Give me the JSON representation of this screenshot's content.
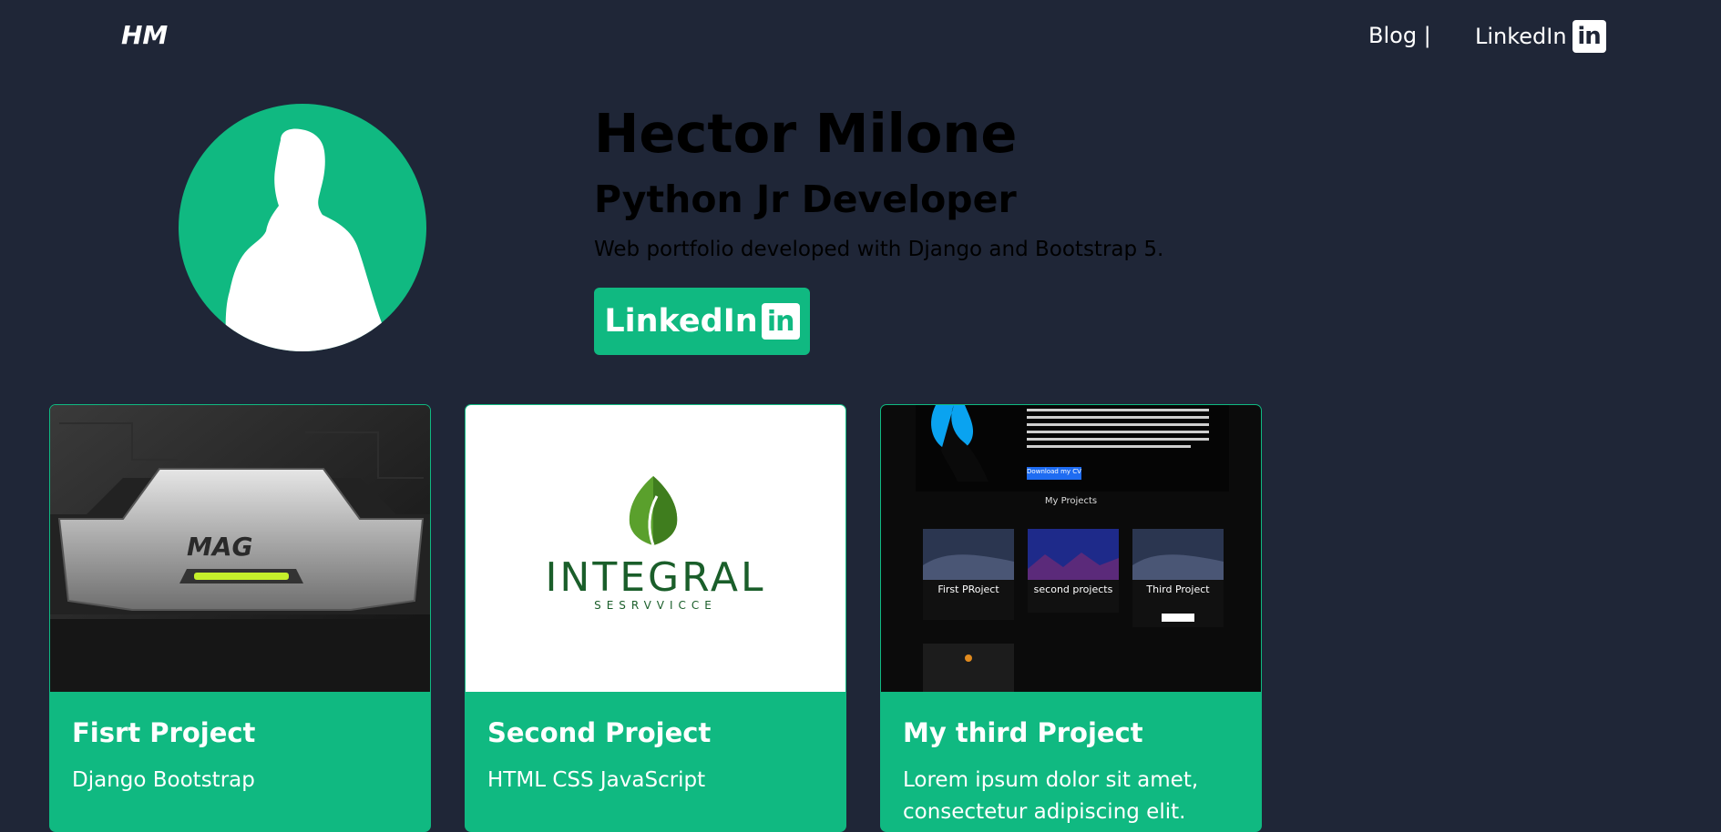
{
  "nav": {
    "brand": "HM",
    "blog": "Blog |",
    "linkedin": "LinkedIn",
    "linkedin_icon_text": "in"
  },
  "hero": {
    "name": "Hector Milone",
    "role": "Python Jr Developer",
    "description": "Web portfolio developed with Django and Bootstrap 5.",
    "button_label": "LinkedIn",
    "button_icon_text": "in"
  },
  "cards": [
    {
      "title": "Fisrt Project",
      "text": "Django Bootstrap",
      "image_label": "MAG"
    },
    {
      "title": "Second Project",
      "text": "HTML CSS JavaScript",
      "image_label": "INTEGRAL",
      "image_sublabel": "SESRVVICCE"
    },
    {
      "title": "My third Project",
      "text": "Lorem ipsum dolor sit amet, consectetur adipiscing elit. Morbi",
      "preview": {
        "button": "Download my CV",
        "heading": "My Projects",
        "tiles": [
          "First PRoject",
          "second projects",
          "Third Project"
        ]
      }
    }
  ],
  "colors": {
    "background": "#1f2637",
    "accent": "#10b981",
    "text_light": "#ffffff"
  },
  "icons": {
    "linkedin": "linkedin-icon",
    "avatar": "person-silhouette-icon",
    "leaf": "leaf-icon"
  }
}
